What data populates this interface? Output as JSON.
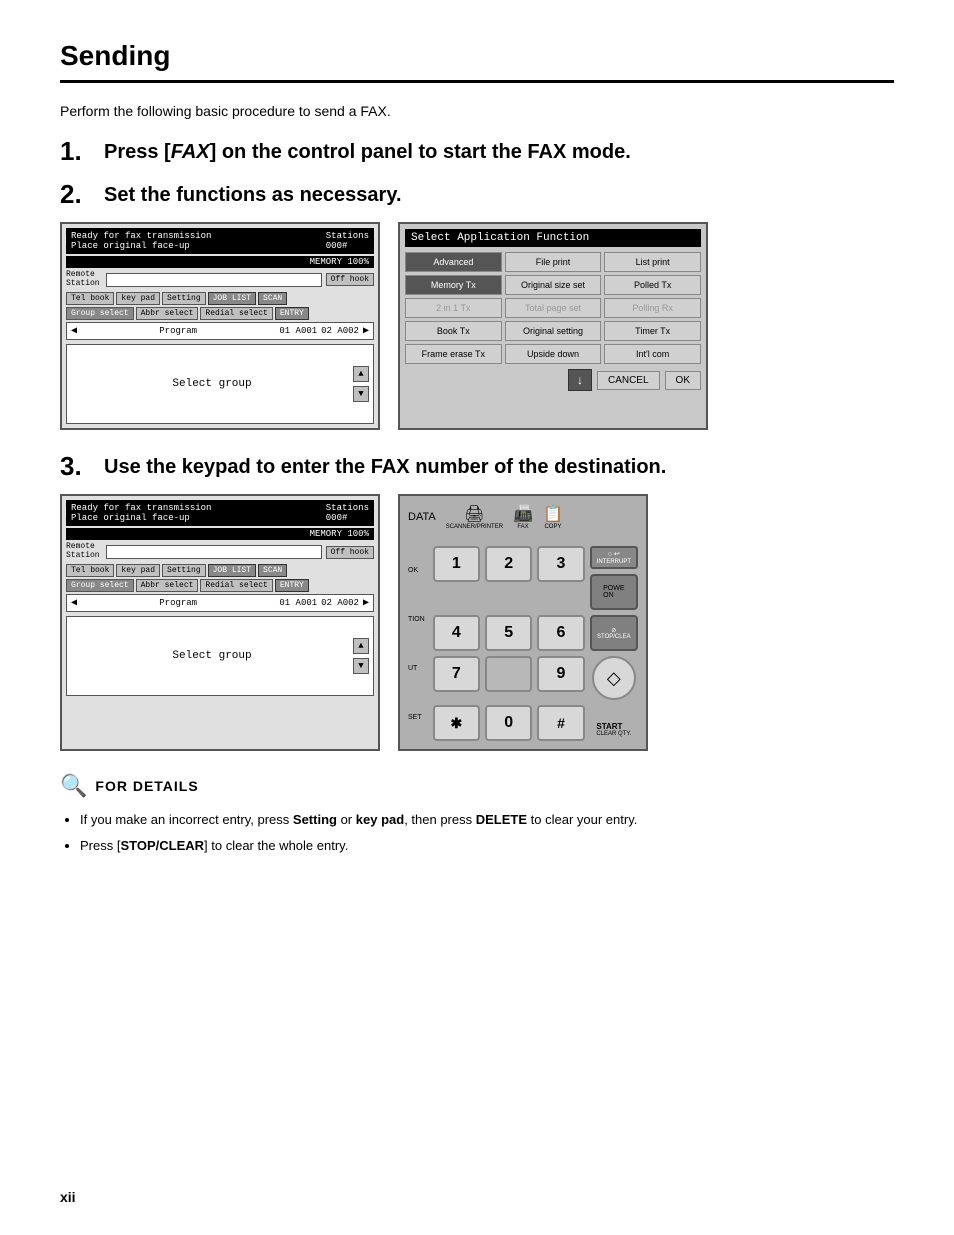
{
  "page": {
    "title": "Sending",
    "footer": "xii"
  },
  "intro": {
    "text": "Perform the following basic procedure to send a FAX."
  },
  "steps": [
    {
      "number": "1.",
      "text_before": "Press [",
      "italic": "FAX",
      "text_after": "] on the control panel to start the FAX mode."
    },
    {
      "number": "2.",
      "text": "Set the functions as necessary."
    },
    {
      "number": "3.",
      "text": "Use the keypad to enter the FAX number of the destination."
    }
  ],
  "fax_panel": {
    "top_line1": "Ready for fax transmission",
    "top_line2": "Place original face-up",
    "stations_label": "Stations",
    "stations_value": "000#",
    "memory_label": "MEMORY 100%",
    "remote_label": "Remote\nStation",
    "off_hook": "Off hook",
    "tel_book": "Tel book",
    "key_pad": "key pad",
    "setting": "Setting",
    "job_list": "JOB LIST",
    "scan": "SCAN",
    "group_select": "Group select",
    "abbr_select": "Abbr select",
    "redial_select": "Redial select",
    "entry": "ENTRY",
    "program": "Program",
    "prog_item1": "01 A001",
    "prog_item2": "02 A002",
    "select_group": "Select group"
  },
  "app_panel": {
    "title": "Select Application Function",
    "buttons": [
      {
        "label": "Advanced",
        "style": "highlighted"
      },
      {
        "label": "File print",
        "style": "normal"
      },
      {
        "label": "List print",
        "style": "normal"
      },
      {
        "label": "Memory Tx",
        "style": "highlighted"
      },
      {
        "label": "Original size set",
        "style": "normal"
      },
      {
        "label": "Polled Tx",
        "style": "normal"
      },
      {
        "label": "2 in 1 Tx",
        "style": "greyed"
      },
      {
        "label": "Total page set",
        "style": "greyed"
      },
      {
        "label": "Polling Rx",
        "style": "greyed"
      },
      {
        "label": "Book Tx",
        "style": "normal"
      },
      {
        "label": "Original setting",
        "style": "normal"
      },
      {
        "label": "Timer Tx",
        "style": "normal"
      },
      {
        "label": "Frame erase Tx",
        "style": "normal"
      },
      {
        "label": "Upside down",
        "style": "normal"
      },
      {
        "label": "Int'l com",
        "style": "normal"
      }
    ],
    "cancel_label": "CANCEL",
    "ok_label": "OK"
  },
  "keypad_panel": {
    "keys": [
      "1",
      "2",
      "3",
      "4",
      "5",
      "6",
      "7",
      "",
      "9",
      "*",
      "0",
      "#"
    ],
    "start_label": "START",
    "stop_label": "STOP/CLEA",
    "power_label": "POWE\nON",
    "interrupt_label": "INTERRUPT",
    "clear_qty_label": "CLEAR QTY.",
    "side_labels": [
      "OK",
      "TION",
      "UT",
      "SET"
    ]
  },
  "notes": {
    "for_details_label": "FOR DETAILS",
    "bullets": [
      {
        "text_before": "If you make an incorrect entry, press ",
        "bold1": "Setting",
        "text_mid": " or ",
        "bold2": "key pad",
        "text_mid2": ", then press ",
        "bold3": "DELETE",
        "text_after": " to clear your entry."
      },
      {
        "text_before": "Press [",
        "bold1": "STOP/CLEAR",
        "text_after": "] to clear the whole entry."
      }
    ]
  }
}
